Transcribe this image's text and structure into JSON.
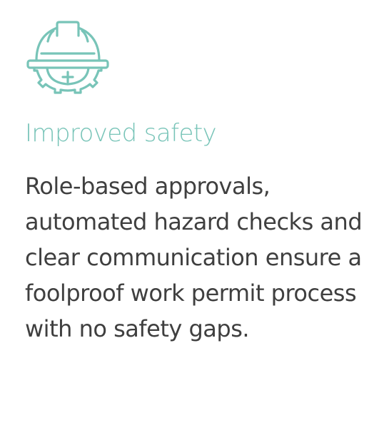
{
  "colors": {
    "accent": "#78c4b8",
    "text": "#3f3f3f",
    "background": "#ffffff"
  },
  "feature": {
    "icon": "hard-hat-gear-icon",
    "title": "Improved safety",
    "description_lines": [
      "Role-based approvals,",
      "automated hazard checks and",
      "clear communication ensure a",
      "foolproof work permit process",
      "with no safety gaps."
    ]
  }
}
